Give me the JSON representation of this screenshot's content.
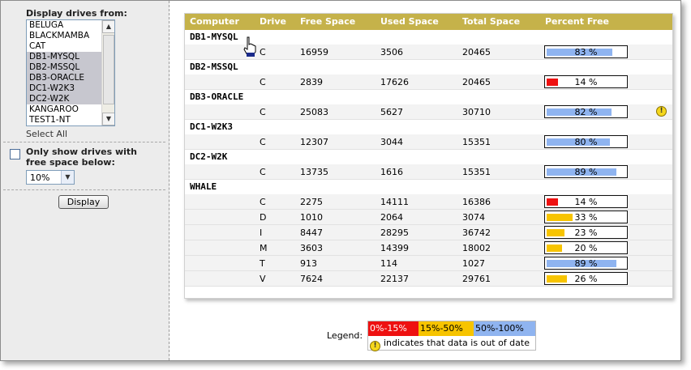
{
  "sidebar": {
    "display_drives_label": "Display drives from:",
    "servers": [
      {
        "name": "BELUGA",
        "selected": false
      },
      {
        "name": "BLACKMAMBA",
        "selected": false
      },
      {
        "name": "CAT",
        "selected": false
      },
      {
        "name": "DB1-MYSQL",
        "selected": true
      },
      {
        "name": "DB2-MSSQL",
        "selected": true
      },
      {
        "name": "DB3-ORACLE",
        "selected": true
      },
      {
        "name": "DC1-W2K3",
        "selected": true
      },
      {
        "name": "DC2-W2K",
        "selected": true
      },
      {
        "name": "KANGAROO",
        "selected": false
      },
      {
        "name": "TEST1-NT",
        "selected": false
      }
    ],
    "select_all": "Select All",
    "only_show_label": "Only show drives with free space below:",
    "only_show_checked": false,
    "threshold_value": "10%",
    "display_button": "Display"
  },
  "table": {
    "headers": {
      "computer": "Computer",
      "drive": "Drive",
      "free": "Free Space",
      "used": "Used Space",
      "total": "Total Space",
      "percent": "Percent Free"
    },
    "groups": [
      {
        "computer": "DB1-MYSQL",
        "drives": [
          {
            "drive": "C",
            "free": "16959",
            "used": "3506",
            "total": "20465",
            "percent": 83,
            "percent_label": "83 %",
            "out_of_date": false
          }
        ]
      },
      {
        "computer": "DB2-MSSQL",
        "drives": [
          {
            "drive": "C",
            "free": "2839",
            "used": "17626",
            "total": "20465",
            "percent": 14,
            "percent_label": "14 %",
            "out_of_date": false
          }
        ]
      },
      {
        "computer": "DB3-ORACLE",
        "drives": [
          {
            "drive": "C",
            "free": "25083",
            "used": "5627",
            "total": "30710",
            "percent": 82,
            "percent_label": "82 %",
            "out_of_date": true
          }
        ]
      },
      {
        "computer": "DC1-W2K3",
        "drives": [
          {
            "drive": "C",
            "free": "12307",
            "used": "3044",
            "total": "15351",
            "percent": 80,
            "percent_label": "80 %",
            "out_of_date": false
          }
        ]
      },
      {
        "computer": "DC2-W2K",
        "drives": [
          {
            "drive": "C",
            "free": "13735",
            "used": "1616",
            "total": "15351",
            "percent": 89,
            "percent_label": "89 %",
            "out_of_date": false
          }
        ]
      },
      {
        "computer": "WHALE",
        "drives": [
          {
            "drive": "C",
            "free": "2275",
            "used": "14111",
            "total": "16386",
            "percent": 14,
            "percent_label": "14 %",
            "out_of_date": false
          },
          {
            "drive": "D",
            "free": "1010",
            "used": "2064",
            "total": "3074",
            "percent": 33,
            "percent_label": "33 %",
            "out_of_date": false
          },
          {
            "drive": "I",
            "free": "8447",
            "used": "28295",
            "total": "36742",
            "percent": 23,
            "percent_label": "23 %",
            "out_of_date": false
          },
          {
            "drive": "M",
            "free": "3603",
            "used": "14399",
            "total": "18002",
            "percent": 20,
            "percent_label": "20 %",
            "out_of_date": false
          },
          {
            "drive": "T",
            "free": "913",
            "used": "114",
            "total": "1027",
            "percent": 89,
            "percent_label": "89 %",
            "out_of_date": false
          },
          {
            "drive": "V",
            "free": "7624",
            "used": "22137",
            "total": "29761",
            "percent": 26,
            "percent_label": "26 %",
            "out_of_date": false
          }
        ]
      }
    ]
  },
  "legend": {
    "label": "Legend:",
    "ranges": [
      {
        "text": "0%-15%",
        "color": "#ee1111",
        "text_color": "#ffffff"
      },
      {
        "text": "15%-50%",
        "color": "#f7c400",
        "text_color": "#000000"
      },
      {
        "text": "50%-100%",
        "color": "#8fb4f0",
        "text_color": "#000000"
      }
    ],
    "note": "indicates that data is out of date"
  },
  "colors": {
    "low": "#ee1111",
    "mid": "#f7c400",
    "high": "#8fb4f0",
    "header": "#c5b24a"
  },
  "icons": {
    "warning": "warning-icon",
    "cursor": "hand-cursor-icon"
  }
}
